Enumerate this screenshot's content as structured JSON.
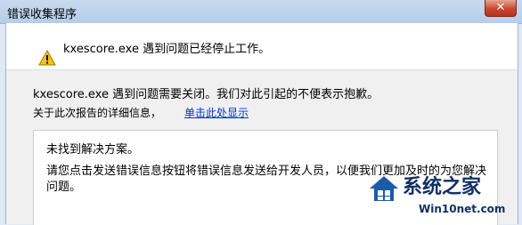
{
  "window": {
    "title": "错误收集程序",
    "close_glyph": "✕"
  },
  "header": {
    "message": "kxescore.exe 遇到问题已经停止工作。"
  },
  "body": {
    "line1": "kxescore.exe 遇到问题需要关闭。我们对此引起的不便表示抱歉。",
    "line2": "关于此次报告的详细信息，",
    "details_link": "单击此处显示"
  },
  "panel": {
    "title": "未找到解决方案。",
    "text": "请您点击发送错误信息按钮将错误信息发送给开发人员，以便我们更加及时的为您解决问题。"
  },
  "watermark": {
    "brand": "系统之家",
    "site": "Win10net.com"
  },
  "colors": {
    "link": "#0033cc",
    "titlebar": "#c8daef",
    "warning": "#f2c417"
  },
  "icons": {
    "warning": "warning-icon",
    "close": "close-icon"
  }
}
